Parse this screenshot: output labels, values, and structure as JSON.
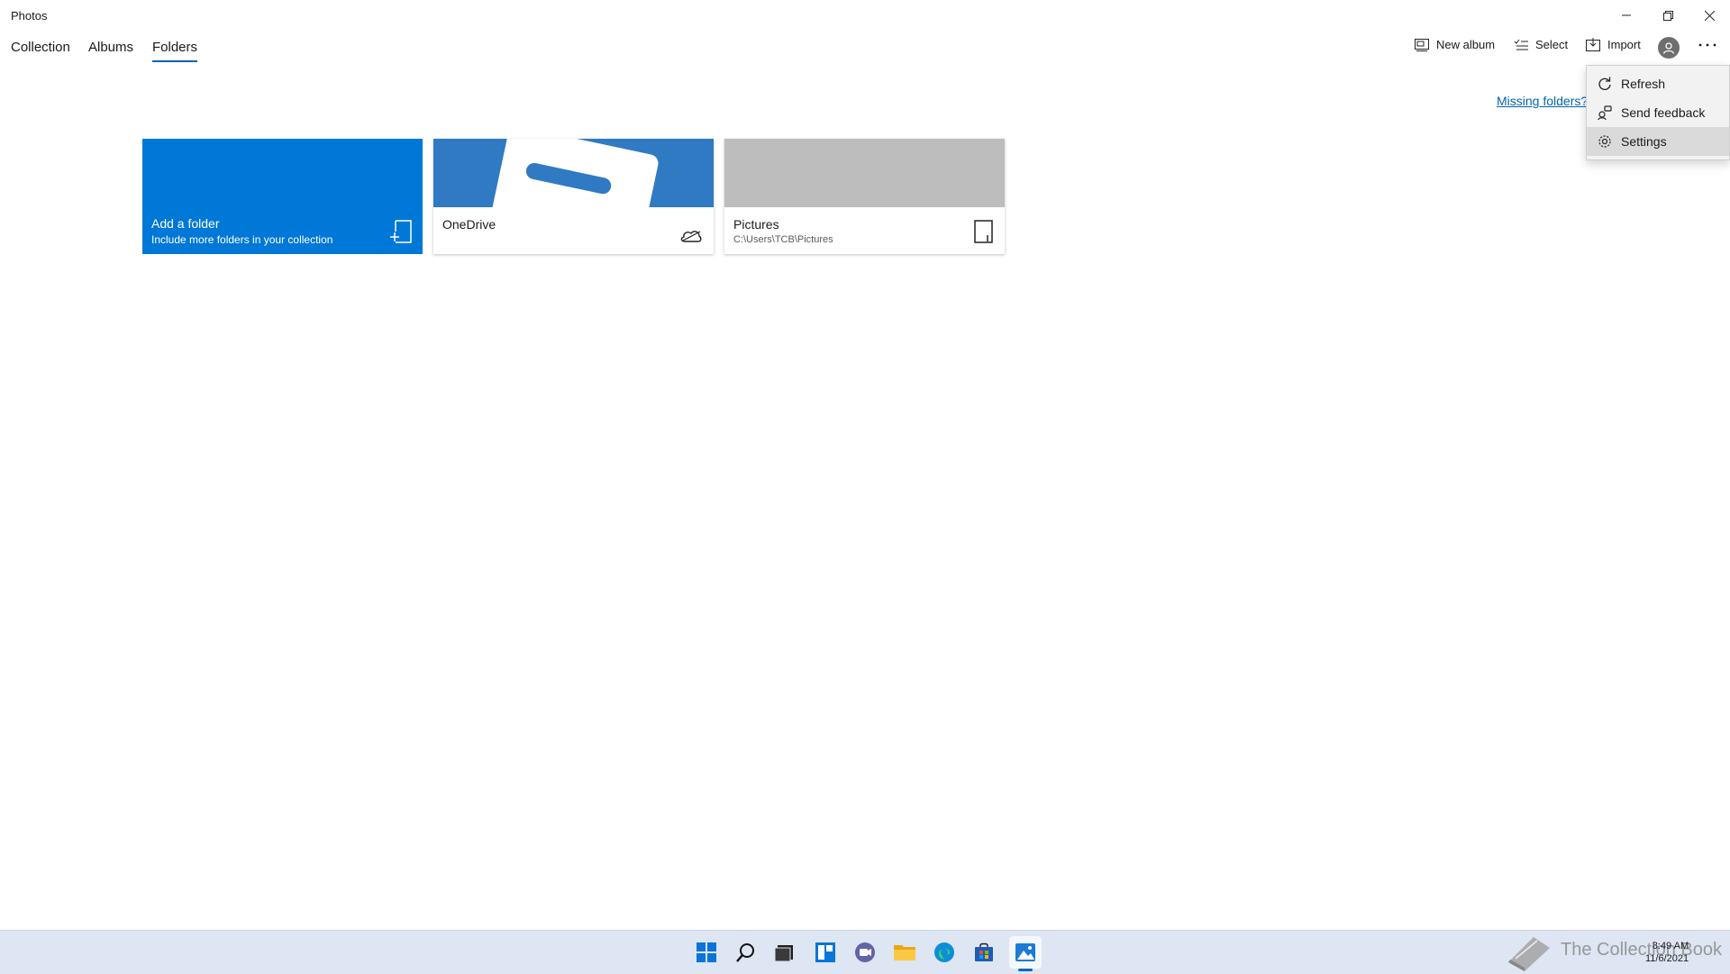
{
  "window": {
    "title": "Photos"
  },
  "nav": {
    "tabs": [
      {
        "label": "Collection"
      },
      {
        "label": "Albums"
      },
      {
        "label": "Folders",
        "active": true
      }
    ]
  },
  "toolbar": {
    "new_album": "New album",
    "select": "Select",
    "import": "Import"
  },
  "missing_folders": "Missing folders?",
  "menu": {
    "items": [
      {
        "label": "Refresh",
        "icon": "refresh-icon"
      },
      {
        "label": "Send feedback",
        "icon": "feedback-icon"
      },
      {
        "label": "Settings",
        "icon": "gear-icon",
        "hover": true
      }
    ]
  },
  "tiles": {
    "add": {
      "title": "Add a folder",
      "subtitle": "Include more folders in your collection",
      "icon": "add-folder-icon"
    },
    "onedrive": {
      "title": "OneDrive",
      "icon": "cloud-icon"
    },
    "pictures": {
      "title": "Pictures",
      "subtitle": "C:\\Users\\TCB\\Pictures",
      "icon": "drive-icon"
    }
  },
  "taskbar": {
    "icons": [
      "start-icon",
      "search-icon",
      "task-view-icon",
      "widgets-icon",
      "chat-icon",
      "file-explorer-icon",
      "edge-icon",
      "store-icon",
      "photos-icon"
    ],
    "time": "8:49 AM",
    "date": "11/6/2021"
  },
  "watermark": "The Collection Book",
  "colors": {
    "accent": "#0078d7",
    "link": "#0063b1",
    "taskbar": "#dde6f2"
  }
}
